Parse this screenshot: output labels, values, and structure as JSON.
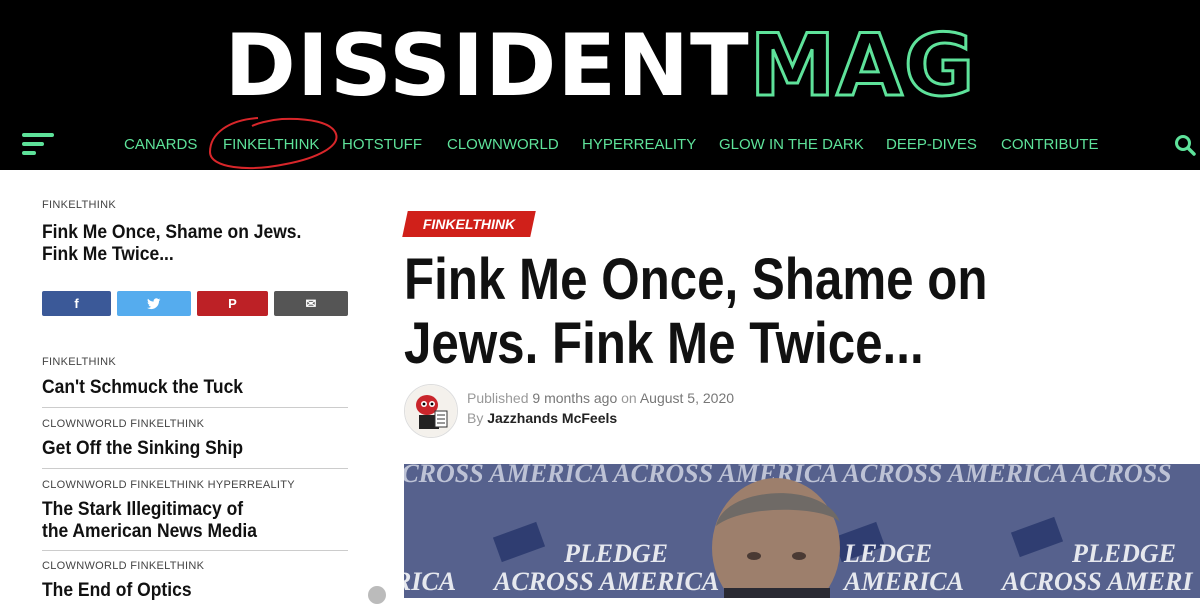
{
  "header": {
    "logo_part1": "DISSIDENT",
    "logo_part2": "MAG",
    "accent_color": "#5ee29a",
    "nav": [
      "CANARDS",
      "FINKELTHINK",
      "HOTSTUFF",
      "CLOWNWORLD",
      "HYPERREALITY",
      "GLOW IN THE DARK",
      "DEEP-DIVES",
      "CONTRIBUTE"
    ],
    "highlighted_nav": "FINKELTHINK",
    "menu_icon": "hamburger-icon",
    "search_icon": "search-icon"
  },
  "sidebar": {
    "featured": {
      "category": "FINKELTHINK",
      "title": "Fink Me Once, Shame on Jews. Fink Me Twice..."
    },
    "share": [
      {
        "icon": "facebook-icon",
        "glyph": "f",
        "color": "#3b5998"
      },
      {
        "icon": "twitter-icon",
        "glyph": "🐦",
        "color": "#55acee"
      },
      {
        "icon": "pinterest-icon",
        "glyph": "P",
        "color": "#bd2126"
      },
      {
        "icon": "email-icon",
        "glyph": "✉",
        "color": "#555555"
      }
    ],
    "items": [
      {
        "category": "FINKELTHINK",
        "title": "Can't Schmuck the Tuck"
      },
      {
        "category": "CLOWNWORLD FINKELTHINK",
        "title": "Get Off the Sinking Ship"
      },
      {
        "category": "CLOWNWORLD FINKELTHINK HYPERREALITY",
        "title": "The Stark Illegitimacy of the American News Media"
      },
      {
        "category": "CLOWNWORLD FINKELTHINK",
        "title": "The End of Optics"
      }
    ]
  },
  "article": {
    "category_badge": "FINKELTHINK",
    "headline": "Fink Me Once, Shame on Jews. Fink Me Twice...",
    "published_label": "Published",
    "published_ago": "9 months ago",
    "on_label": "on",
    "published_date": "August 5, 2020",
    "by_label": "By",
    "author": "Jazzhands McFeels",
    "photo_banner_text": "PLEDGE ACROSS AMERICA"
  }
}
